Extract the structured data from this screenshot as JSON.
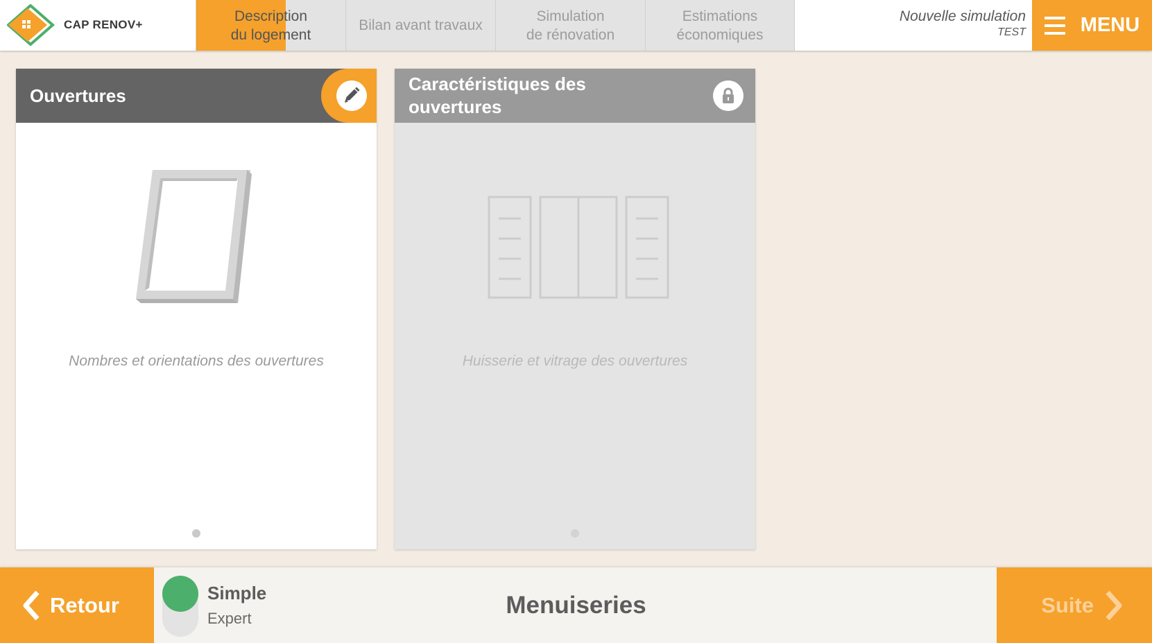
{
  "brand": {
    "name": "CAP RENOV+",
    "accent_color": "#f5a12b",
    "green_color": "#4caf6b"
  },
  "header": {
    "tabs": [
      {
        "label": "Description\ndu logement",
        "active": true,
        "progress": 0.6
      },
      {
        "label": "Bilan avant travaux",
        "active": false
      },
      {
        "label": "Simulation\nde rénovation",
        "active": false
      },
      {
        "label": "Estimations\néconomiques",
        "active": false
      }
    ],
    "simulation_title": "Nouvelle simulation",
    "simulation_name": "TEST",
    "menu_label": "MENU",
    "menu_icon": "hamburger-icon"
  },
  "cards": [
    {
      "title": "Ouvertures",
      "caption": "Nombres et orientations des ouvertures",
      "icon": "window-icon",
      "action_icon": "pencil-icon",
      "locked": false
    },
    {
      "title": "Caractéristiques des ouvertures",
      "caption": "Huisserie et vitrage des ouvertures",
      "icon": "window-frames-icon",
      "action_icon": "lock-icon",
      "locked": true
    }
  ],
  "footer": {
    "back_label": "Retour",
    "next_label": "Suite",
    "mode_simple": "Simple",
    "mode_expert": "Expert",
    "mode_selected": "Simple",
    "section_title": "Menuiseries"
  }
}
